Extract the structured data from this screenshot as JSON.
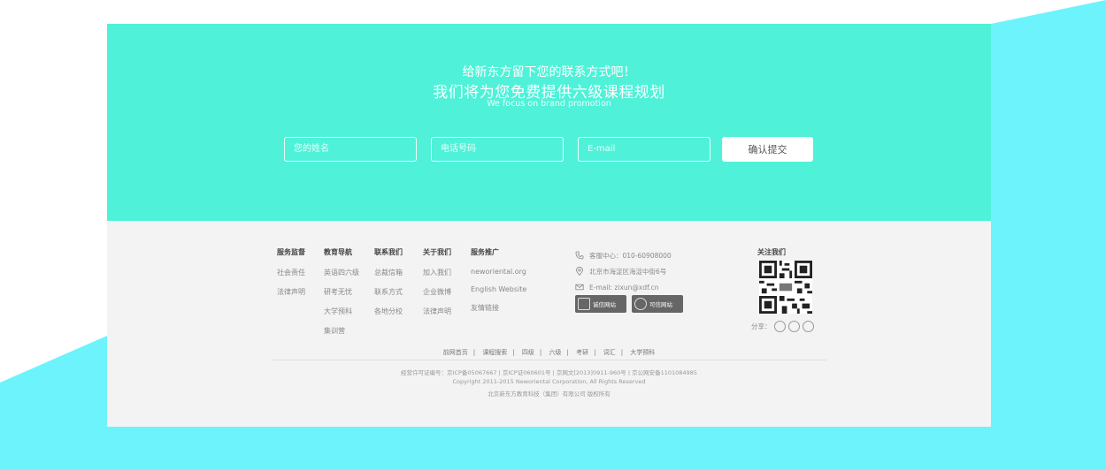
{
  "hero": {
    "line1": "给新东方留下您的联系方式吧！",
    "line2": "我们将为您免费提供六级课程规划",
    "line3": "We focus on brand promotion"
  },
  "form": {
    "name_placeholder": "您的姓名",
    "phone_placeholder": "电话号码",
    "email_placeholder": "E-mail",
    "submit_label": "确认提交"
  },
  "footer": {
    "columns": [
      {
        "head": "服务监督",
        "items": [
          "社会责任",
          "法律声明"
        ]
      },
      {
        "head": "教育导航",
        "items": [
          "英语四六级",
          "研考无忧",
          "大学预科",
          "集训营"
        ]
      },
      {
        "head": "联系我们",
        "items": [
          "总裁信箱",
          "联系方式",
          "各地分校"
        ]
      },
      {
        "head": "关于我们",
        "items": [
          "加入我们",
          "企业微博",
          "法律声明"
        ]
      },
      {
        "head": "服务推广",
        "items": [
          "neworiental.org",
          "English Website",
          "友情链接"
        ]
      }
    ],
    "contact": {
      "phone": "客服中心：010-60908000",
      "address": "北京市海淀区海淀中街6号",
      "email": "E-mail: zixun@xdf.cn"
    },
    "badges": [
      "诚信网站",
      "可信网站"
    ],
    "follow_label": "关注我们",
    "share_label": "分享：",
    "links": [
      "前网首页",
      "课程搜索",
      "四级",
      "六级",
      "考研",
      "词汇",
      "大学预科"
    ],
    "copyright": [
      "经营许可证编号：京ICP备05067667 | 京ICP证060601号 | 京网文[2013]0911-960号 | 京公网安备1101084985",
      "Copyright 2011-2015 Neworiental Corporation, All Rights Reserved",
      "北京新东方教育科技（集团）有限公司    版权所有"
    ]
  },
  "colors": {
    "hero": "#4ff2d8",
    "background_shape": "#6df3fb",
    "footer": "#f3f3f3"
  }
}
